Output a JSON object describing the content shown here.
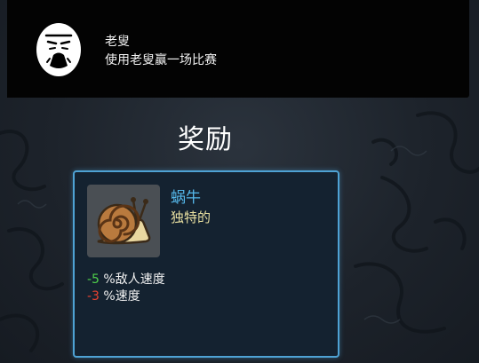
{
  "character": {
    "name": "老叟",
    "description": "使用老叟赢一场比赛",
    "icon": "old-man-icon"
  },
  "reward": {
    "title": "奖励",
    "item": {
      "name": "蜗牛",
      "rarity": "独特的",
      "icon": "snail-icon",
      "name_color": "#54b6e8",
      "rarity_color": "#e8dfa0"
    },
    "stats": [
      {
        "value": "-5",
        "label": "%敌人速度",
        "color": "#4fd04a"
      },
      {
        "value": "-3",
        "label": "%速度",
        "color": "#e8412f"
      }
    ]
  }
}
